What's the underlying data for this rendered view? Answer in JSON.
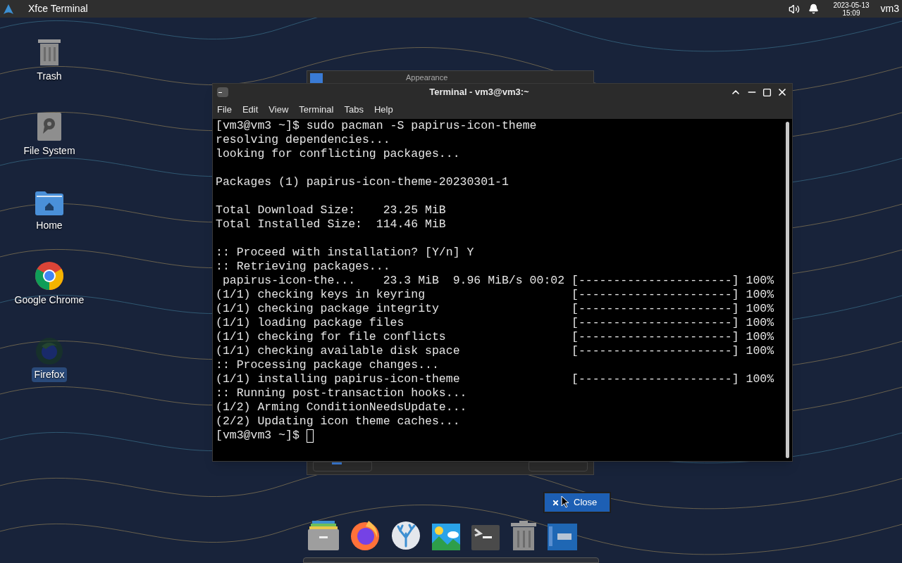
{
  "top_panel": {
    "app_title": "Xfce Terminal",
    "date": "2023-05-13",
    "time": "15:09",
    "user": "vm3"
  },
  "desktop_icons": [
    {
      "kind": "trash",
      "label": "Trash",
      "selected": false
    },
    {
      "kind": "drive",
      "label": "File System",
      "selected": false
    },
    {
      "kind": "home",
      "label": "Home",
      "selected": false
    },
    {
      "kind": "chrome",
      "label": "Google Chrome",
      "selected": false
    },
    {
      "kind": "firefox",
      "label": "Firefox",
      "selected": true
    }
  ],
  "background_window": {
    "title": "Appearance"
  },
  "terminal": {
    "title": "Terminal - vm3@vm3:~",
    "menu": [
      "File",
      "Edit",
      "View",
      "Terminal",
      "Tabs",
      "Help"
    ],
    "blocks": [
      [
        "[vm3@vm3 ~]$ sudo pacman -S papirus-icon-theme",
        "resolving dependencies...",
        "looking for conflicting packages..."
      ],
      [
        "Packages (1) papirus-icon-theme-20230301-1"
      ],
      [
        "Total Download Size:    23.25 MiB",
        "Total Installed Size:  114.46 MiB"
      ],
      [
        ":: Proceed with installation? [Y/n] Y",
        ":: Retrieving packages...",
        " papirus-icon-the...    23.3 MiB  9.96 MiB/s 00:02 [----------------------] 100%",
        "(1/1) checking keys in keyring                     [----------------------] 100%",
        "(1/1) checking package integrity                   [----------------------] 100%",
        "(1/1) loading package files                        [----------------------] 100%",
        "(1/1) checking for file conflicts                  [----------------------] 100%",
        "(1/1) checking available disk space                [----------------------] 100%",
        ":: Processing package changes...",
        "(1/1) installing papirus-icon-theme                [----------------------] 100%",
        ":: Running post-transaction hooks...",
        "(1/2) Arming ConditionNeedsUpdate...",
        "(2/2) Updating icon theme caches...",
        "[vm3@vm3 ~]$ "
      ]
    ]
  },
  "context_menu": {
    "items": [
      {
        "label": "Close",
        "selected": true
      }
    ]
  }
}
